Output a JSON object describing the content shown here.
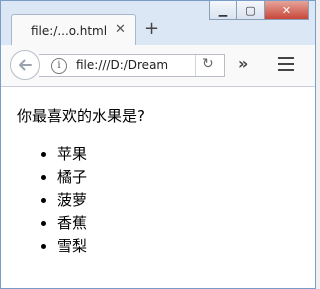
{
  "browser": {
    "tab_title": "file:/...o.html",
    "tab_close": "✕",
    "new_tab": "+",
    "url": "file:///D:/Dream",
    "info_icon": "i",
    "reload_icon": "↻",
    "overflow": "»",
    "window_buttons": {
      "minimize": "▁",
      "maximize": "▢",
      "close": "✕"
    }
  },
  "page": {
    "question": "你最喜欢的水果是?",
    "fruits": [
      "苹果",
      "橘子",
      "菠萝",
      "香蕉",
      "雪梨"
    ]
  }
}
